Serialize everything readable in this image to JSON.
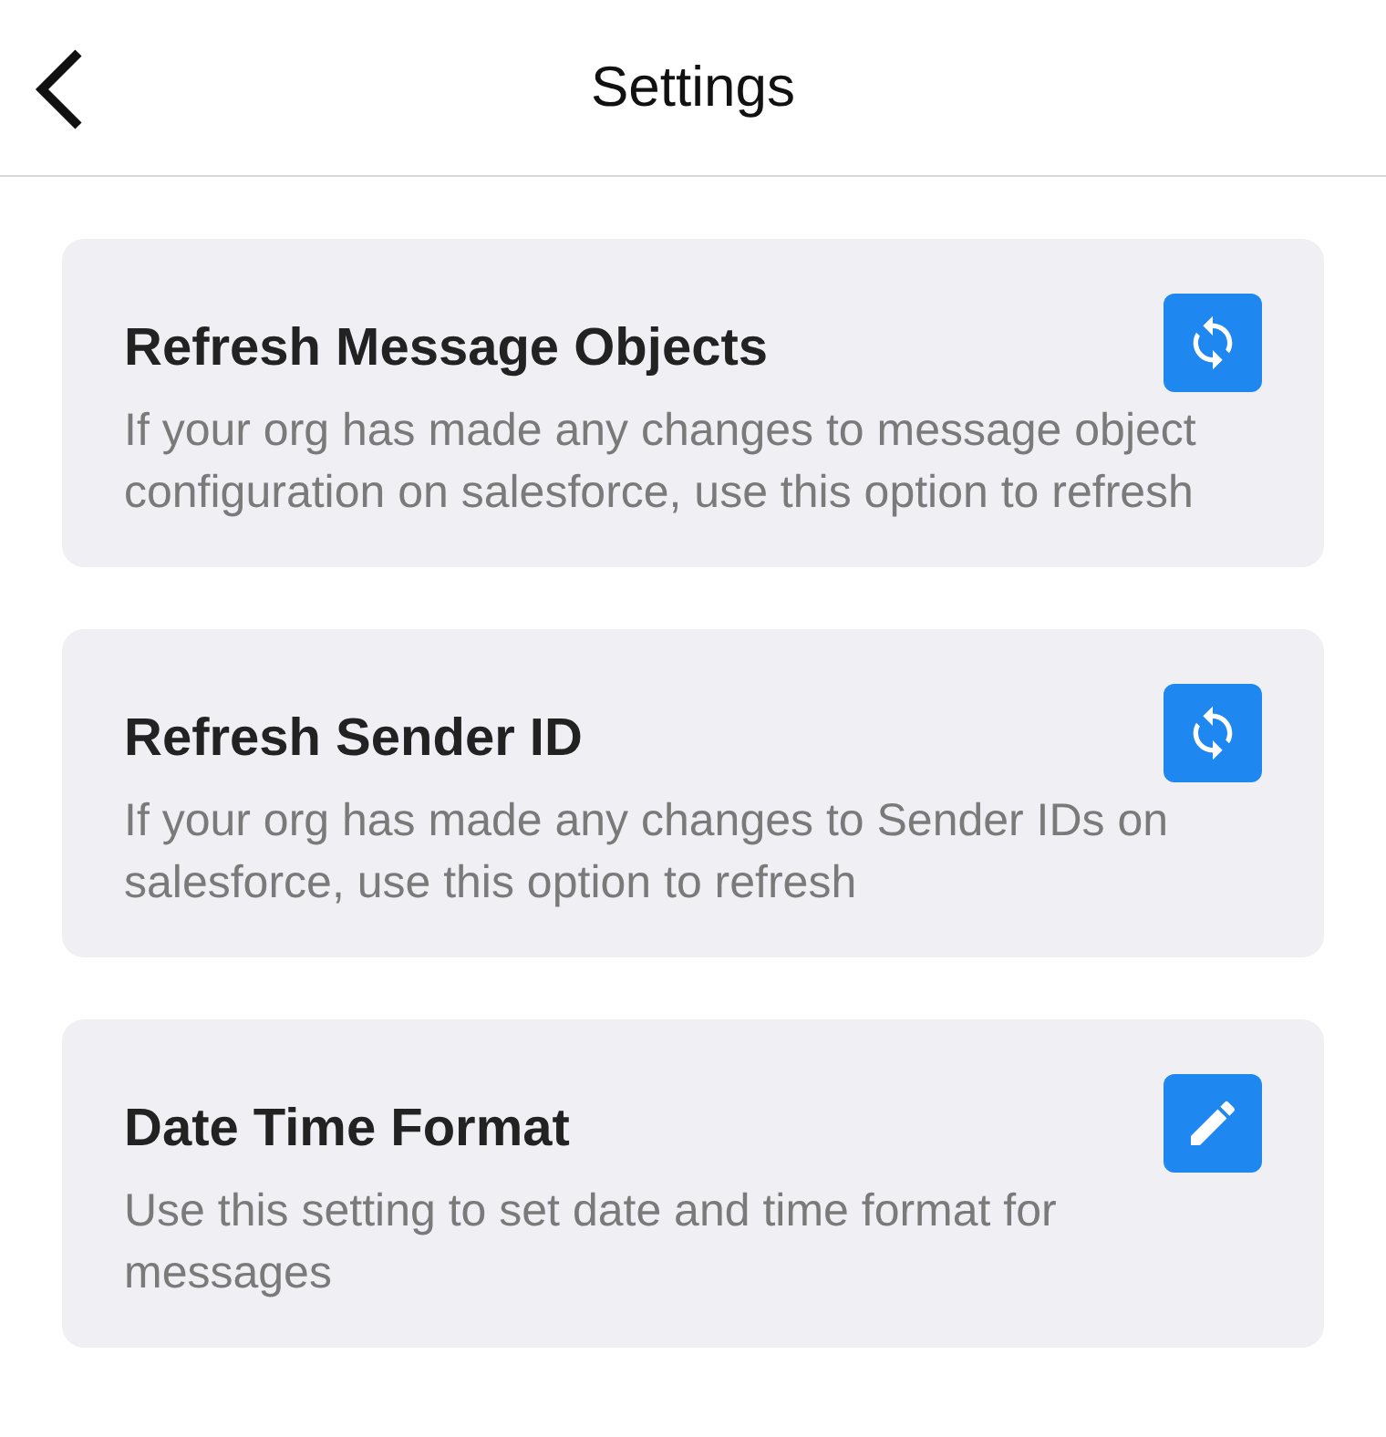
{
  "header": {
    "title": "Settings"
  },
  "cards": [
    {
      "kind": "refresh",
      "title": "Refresh Message Objects",
      "description": "If your org has made any changes to message object configuration on salesforce, use this option to refresh"
    },
    {
      "kind": "refresh",
      "title": "Refresh Sender ID",
      "description": "If your org has made any changes to Sender IDs on salesforce, use this option to refresh"
    },
    {
      "kind": "edit",
      "title": "Date Time Format",
      "description": "Use this setting to set date and time format for messages"
    }
  ]
}
